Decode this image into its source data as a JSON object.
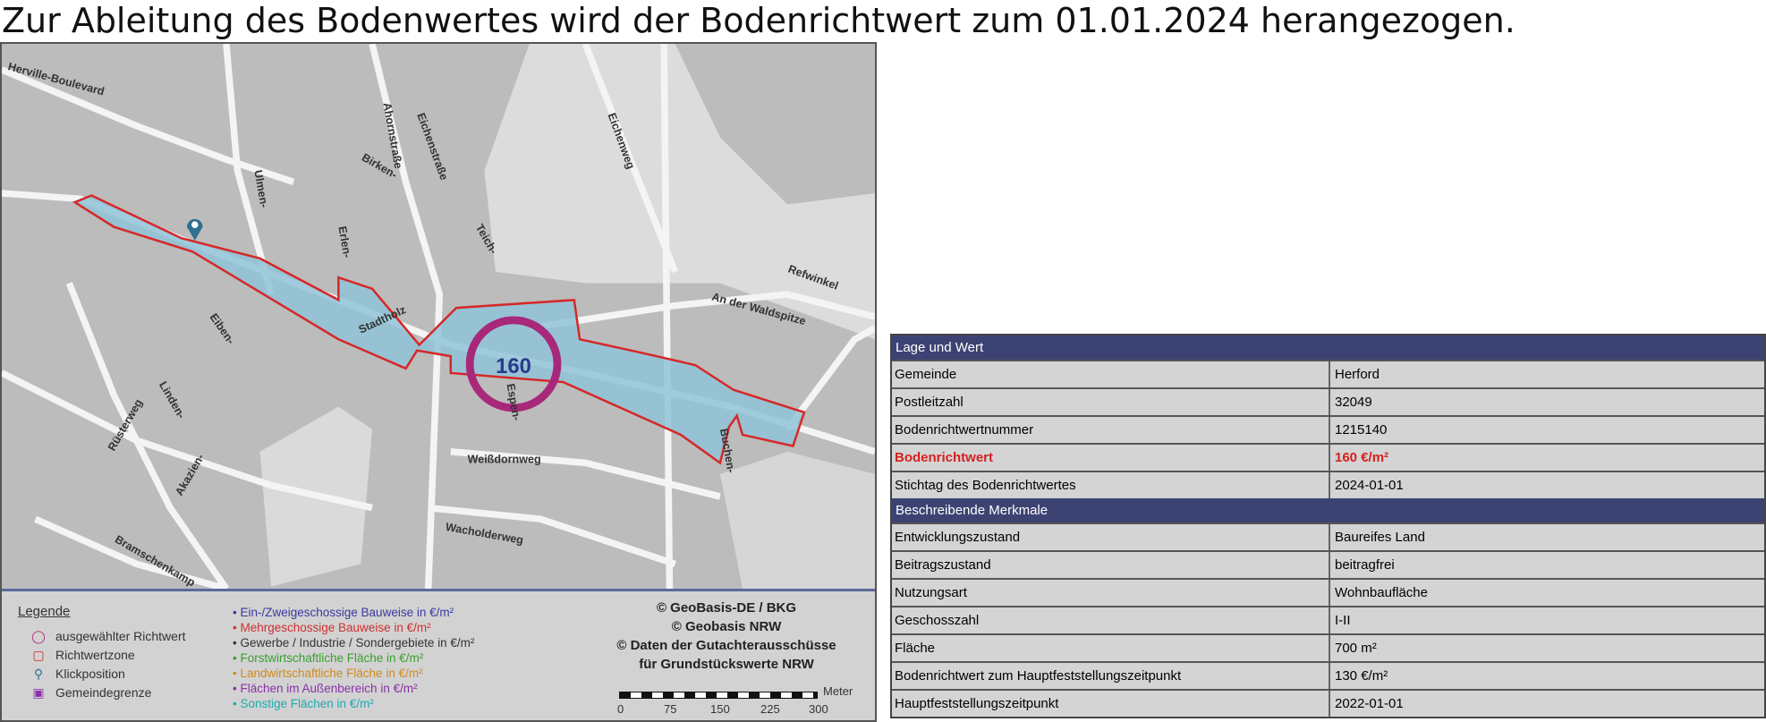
{
  "title": "Zur Ableitung des Bodenwertes wird der Bodenrichtwert zum 01.01.2024 herangezogen.",
  "map": {
    "zone_value": "160",
    "street_labels": [
      "Herville-Boulevard",
      "Stadtholz",
      "Birken-",
      "Eichenstraße",
      "Ahornstraße",
      "Ulmen-",
      "Eiben-",
      "Linden-",
      "Rüsterweg",
      "Weißdornweg",
      "Wacholderweg",
      "Refwinkel",
      "An der Waldspitze",
      "Teich-",
      "Eichenweg",
      "Buchen-",
      "Bramschenkamp",
      "Akazien-",
      "Erlen-",
      "Espen-"
    ],
    "colors": {
      "zone_fill": "#8fc3d8",
      "zone_border": "#d62828",
      "selected_circle": "#a8287a",
      "zone_label": "#2a3a8a"
    }
  },
  "legend": {
    "title": "Legende",
    "symbols": [
      {
        "icon": "circle-outline-icon",
        "label": "ausgewählter Richtwert"
      },
      {
        "icon": "square-outline-icon",
        "label": "Richtwertzone"
      },
      {
        "icon": "map-pin-icon",
        "label": "Klickposition"
      },
      {
        "icon": "square-filled-icon",
        "label": "Gemeindegrenze"
      }
    ],
    "categories": [
      {
        "label": "Ein-/Zweigeschossige Bauweise in €/m²",
        "color": "#3a3aa0"
      },
      {
        "label": "Mehrgeschossige Bauweise in €/m²",
        "color": "#d03030"
      },
      {
        "label": "Gewerbe / Industrie / Sondergebiete in €/m²",
        "color": "#333333"
      },
      {
        "label": "Forstwirtschaftliche Fläche in €/m²",
        "color": "#3aa030"
      },
      {
        "label": "Landwirtschaftliche Fläche in €/m²",
        "color": "#d08a20"
      },
      {
        "label": "Flächen im Außenbereich in €/m²",
        "color": "#8a30a8"
      },
      {
        "label": "Sonstige Flächen in €/m²",
        "color": "#20a8b0"
      }
    ],
    "copyright": [
      "© GeoBasis-DE / BKG",
      "© Geobasis NRW",
      "© Daten der Gutachterausschüsse",
      "für Grundstückswerte NRW"
    ],
    "scale": {
      "unit": "Meter",
      "ticks": [
        "0",
        "75",
        "150",
        "225",
        "300"
      ]
    }
  },
  "table": {
    "section1": "Lage und Wert",
    "rows1": [
      {
        "key": "Gemeinde",
        "value": "Herford"
      },
      {
        "key": "Postleitzahl",
        "value": "32049"
      },
      {
        "key": "Bodenrichtwertnummer",
        "value": "1215140"
      },
      {
        "key": "Bodenrichtwert",
        "value": "160 €/m²",
        "highlight": true
      },
      {
        "key": "Stichtag des Bodenrichtwertes",
        "value": "2024-01-01"
      }
    ],
    "section2": "Beschreibende Merkmale",
    "rows2": [
      {
        "key": "Entwicklungszustand",
        "value": "Baureifes Land"
      },
      {
        "key": "Beitragszustand",
        "value": "beitragfrei"
      },
      {
        "key": "Nutzungsart",
        "value": "Wohnbaufläche"
      },
      {
        "key": "Geschosszahl",
        "value": "I-II"
      },
      {
        "key": "Fläche",
        "value": "700 m²"
      },
      {
        "key": "Bodenrichtwert zum Hauptfeststellungszeitpunkt",
        "value": "130 €/m²"
      },
      {
        "key": "Hauptfeststellungszeitpunkt",
        "value": "2022-01-01"
      }
    ]
  }
}
